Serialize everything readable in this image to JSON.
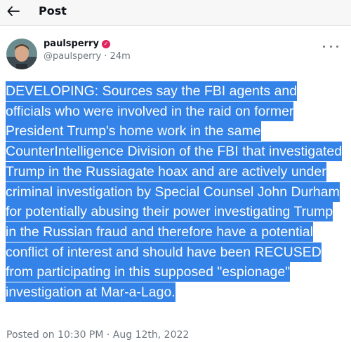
{
  "header": {
    "title": "Post",
    "back_icon": "arrow-left-icon"
  },
  "author": {
    "username": "paulsperry",
    "handle_line": "@paulsperry · 24m",
    "verified_icon": "verified-badge-icon",
    "verified_color": "#e0245e"
  },
  "more_icon": "more-horizontal-icon",
  "tweet": {
    "text": "DEVELOPING: Sources say the FBI agents and officials who were involved in the raid on former President Trump's home work in the same CounterIntelligence Division of the FBI that investigated Trump in the Russiagate hoax and are actively under criminal investigation by Special Counsel John Durham for potentially abusing their power investigating Trump in the Russian fraud and therefore have a potential conflict of interest and should have been RECUSED from participating in this supposed \"espionage\" investigation at Mar-a-Lago.",
    "highlight_color": "#3483e8"
  },
  "timestamp": "Posted on 10:30 PM · Aug 12th, 2022"
}
